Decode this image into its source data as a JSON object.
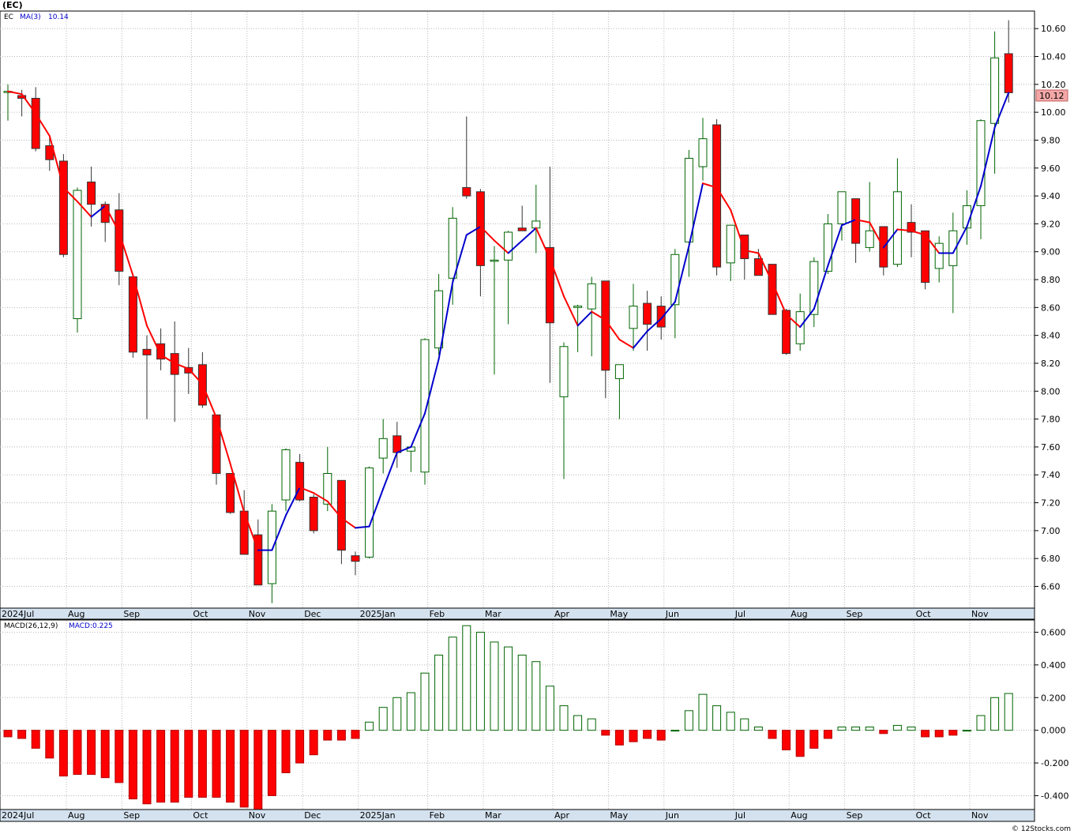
{
  "header": {
    "symbol": "(EC)"
  },
  "footer": {
    "credit": "© 12Stocks.com"
  },
  "colors": {
    "up": "#006400",
    "down": "#ff0000",
    "ma_up": "#0000cc",
    "ma_down": "#ff0000",
    "grid": "#b8b8b8",
    "axis_strip": "#d4e2ef",
    "price_badge": "#f4a7a7"
  },
  "chart_data": [
    {
      "type": "candlestick",
      "legend": {
        "symbol": "EC",
        "indicator": "MA(3)",
        "value": "10.14"
      },
      "last_price_label": "10.12",
      "ylim": [
        6.45,
        10.72
      ],
      "y_ticks": [
        "6.60",
        "6.80",
        "7.00",
        "7.20",
        "7.40",
        "7.60",
        "7.80",
        "8.00",
        "8.20",
        "8.40",
        "8.60",
        "8.80",
        "9.00",
        "9.20",
        "9.40",
        "9.60",
        "9.80",
        "10.00",
        "10.20",
        "10.40",
        "10.60"
      ],
      "x_labels": [
        {
          "label": "2024Jul",
          "bar": 0
        },
        {
          "label": "Aug",
          "bar": 5
        },
        {
          "label": "Sep",
          "bar": 9
        },
        {
          "label": "Oct",
          "bar": 14
        },
        {
          "label": "Nov",
          "bar": 18
        },
        {
          "label": "Dec",
          "bar": 22
        },
        {
          "label": "2025Jan",
          "bar": 26
        },
        {
          "label": "Feb",
          "bar": 31
        },
        {
          "label": "Mar",
          "bar": 35
        },
        {
          "label": "Apr",
          "bar": 40
        },
        {
          "label": "May",
          "bar": 44
        },
        {
          "label": "Jun",
          "bar": 48
        },
        {
          "label": "Jul",
          "bar": 53
        },
        {
          "label": "Aug",
          "bar": 57
        },
        {
          "label": "Sep",
          "bar": 61
        },
        {
          "label": "Oct",
          "bar": 66
        },
        {
          "label": "Nov",
          "bar": 70
        }
      ],
      "ohlc": [
        [
          10.15,
          10.2,
          9.94,
          10.15
        ],
        [
          10.12,
          10.16,
          9.97,
          10.1
        ],
        [
          10.1,
          10.18,
          9.72,
          9.74
        ],
        [
          9.76,
          9.82,
          9.58,
          9.66
        ],
        [
          9.65,
          9.7,
          8.96,
          8.98
        ],
        [
          8.52,
          9.46,
          8.42,
          9.44
        ],
        [
          9.5,
          9.61,
          9.18,
          9.34
        ],
        [
          9.34,
          9.36,
          9.07,
          9.21
        ],
        [
          9.3,
          9.42,
          8.76,
          8.86
        ],
        [
          8.82,
          8.82,
          8.24,
          8.28
        ],
        [
          8.3,
          8.4,
          7.8,
          8.26
        ],
        [
          8.34,
          8.45,
          8.15,
          8.23
        ],
        [
          8.27,
          8.5,
          7.78,
          8.12
        ],
        [
          8.17,
          8.31,
          7.98,
          8.13
        ],
        [
          8.19,
          8.28,
          7.88,
          7.9
        ],
        [
          7.83,
          7.82,
          7.33,
          7.41
        ],
        [
          7.41,
          7.41,
          7.12,
          7.13
        ],
        [
          7.14,
          7.29,
          6.84,
          6.83
        ],
        [
          6.97,
          7.08,
          6.62,
          6.61
        ],
        [
          6.62,
          7.19,
          6.48,
          7.14
        ],
        [
          7.22,
          7.59,
          7.14,
          7.58
        ],
        [
          7.49,
          7.55,
          7.21,
          7.22
        ],
        [
          7.24,
          7.26,
          6.98,
          7.0
        ],
        [
          7.19,
          7.6,
          7.14,
          7.41
        ],
        [
          7.36,
          7.36,
          6.76,
          6.86
        ],
        [
          6.82,
          6.85,
          6.68,
          6.78
        ],
        [
          6.81,
          7.46,
          6.8,
          7.45
        ],
        [
          7.52,
          7.8,
          7.41,
          7.66
        ],
        [
          7.68,
          7.78,
          7.45,
          7.56
        ],
        [
          7.57,
          7.59,
          7.42,
          7.6
        ],
        [
          7.42,
          8.38,
          7.33,
          8.37
        ],
        [
          8.31,
          8.84,
          8.26,
          8.72
        ],
        [
          8.81,
          9.32,
          8.62,
          9.24
        ],
        [
          9.46,
          9.97,
          9.38,
          9.4
        ],
        [
          9.43,
          9.45,
          8.68,
          8.9
        ],
        [
          8.94,
          9.04,
          8.12,
          8.94
        ],
        [
          8.94,
          9.15,
          8.48,
          9.14
        ],
        [
          9.17,
          9.33,
          9.16,
          9.15
        ],
        [
          9.17,
          9.48,
          8.99,
          9.22
        ],
        [
          9.03,
          9.61,
          8.06,
          8.49
        ],
        [
          7.96,
          8.35,
          7.37,
          8.32
        ],
        [
          8.6,
          8.62,
          8.28,
          8.61
        ],
        [
          8.59,
          8.82,
          8.25,
          8.77
        ],
        [
          8.79,
          8.79,
          7.95,
          8.15
        ],
        [
          8.09,
          8.17,
          7.8,
          8.19
        ],
        [
          8.45,
          8.77,
          8.29,
          8.61
        ],
        [
          8.63,
          8.72,
          8.29,
          8.48
        ],
        [
          8.61,
          8.68,
          8.37,
          8.46
        ],
        [
          8.62,
          9.02,
          8.38,
          8.98
        ],
        [
          9.07,
          9.73,
          8.82,
          9.67
        ],
        [
          9.61,
          9.96,
          9.51,
          9.81
        ],
        [
          9.91,
          9.95,
          8.83,
          8.89
        ],
        [
          8.92,
          9.18,
          8.79,
          9.19
        ],
        [
          9.12,
          9.12,
          8.8,
          8.95
        ],
        [
          8.95,
          9.02,
          8.84,
          8.83
        ],
        [
          8.91,
          8.91,
          8.58,
          8.55
        ],
        [
          8.58,
          8.59,
          8.26,
          8.27
        ],
        [
          8.34,
          8.7,
          8.29,
          8.57
        ],
        [
          8.55,
          8.96,
          8.46,
          8.93
        ],
        [
          8.86,
          9.27,
          8.84,
          9.2
        ],
        [
          9.2,
          9.41,
          9.08,
          9.43
        ],
        [
          9.38,
          9.35,
          8.92,
          9.06
        ],
        [
          9.03,
          9.5,
          9.0,
          9.15
        ],
        [
          9.18,
          9.18,
          8.83,
          8.89
        ],
        [
          8.91,
          9.67,
          8.89,
          9.43
        ],
        [
          9.21,
          9.34,
          8.96,
          9.14
        ],
        [
          9.15,
          9.15,
          8.73,
          8.78
        ],
        [
          8.88,
          9.11,
          8.78,
          9.06
        ],
        [
          8.9,
          9.28,
          8.56,
          9.15
        ],
        [
          9.17,
          9.44,
          9.05,
          9.33
        ],
        [
          9.33,
          9.95,
          9.09,
          9.94
        ],
        [
          9.92,
          10.58,
          9.56,
          10.39
        ],
        [
          10.42,
          10.66,
          10.07,
          10.14
        ]
      ],
      "ma3": [
        10.15,
        10.13,
        9.99,
        9.83,
        9.46,
        9.36,
        9.25,
        9.33,
        9.14,
        8.83,
        8.47,
        8.26,
        8.2,
        8.16,
        8.05,
        7.81,
        7.48,
        7.13,
        6.86,
        6.86,
        7.11,
        7.31,
        7.27,
        7.21,
        7.09,
        7.02,
        7.03,
        7.3,
        7.56,
        7.6,
        7.84,
        8.23,
        8.78,
        9.12,
        9.18,
        9.08,
        8.99,
        9.08,
        9.17,
        8.95,
        8.68,
        8.47,
        8.57,
        8.51,
        8.37,
        8.31,
        8.43,
        8.52,
        8.64,
        9.04,
        9.49,
        9.46,
        9.3,
        9.01,
        8.99,
        8.78,
        8.55,
        8.46,
        8.59,
        8.9,
        9.19,
        9.23,
        9.21,
        9.03,
        9.16,
        9.15,
        9.12,
        8.99,
        8.99,
        9.18,
        9.47,
        9.89,
        10.14
      ]
    },
    {
      "type": "bar",
      "legend": {
        "indicator": "MACD(26,12,9)",
        "value": "MACD:0.225"
      },
      "ylim": [
        -0.48,
        0.67
      ],
      "y_ticks": [
        "-0.400",
        "-0.200",
        "0.000",
        "0.200",
        "0.400",
        "0.600"
      ],
      "values": [
        -0.04,
        -0.05,
        -0.11,
        -0.17,
        -0.28,
        -0.27,
        -0.27,
        -0.29,
        -0.32,
        -0.42,
        -0.45,
        -0.44,
        -0.44,
        -0.41,
        -0.41,
        -0.41,
        -0.44,
        -0.47,
        -0.51,
        -0.4,
        -0.26,
        -0.2,
        -0.15,
        -0.06,
        -0.06,
        -0.05,
        0.05,
        0.14,
        0.2,
        0.23,
        0.35,
        0.46,
        0.57,
        0.64,
        0.6,
        0.54,
        0.51,
        0.46,
        0.42,
        0.27,
        0.15,
        0.09,
        0.07,
        -0.03,
        -0.09,
        -0.07,
        -0.05,
        -0.06,
        0.0,
        0.12,
        0.22,
        0.15,
        0.11,
        0.07,
        0.02,
        -0.05,
        -0.12,
        -0.16,
        -0.11,
        -0.05,
        0.02,
        0.02,
        0.02,
        -0.02,
        0.03,
        0.02,
        -0.04,
        -0.04,
        -0.03,
        0.0,
        0.09,
        0.2,
        0.225
      ]
    }
  ]
}
